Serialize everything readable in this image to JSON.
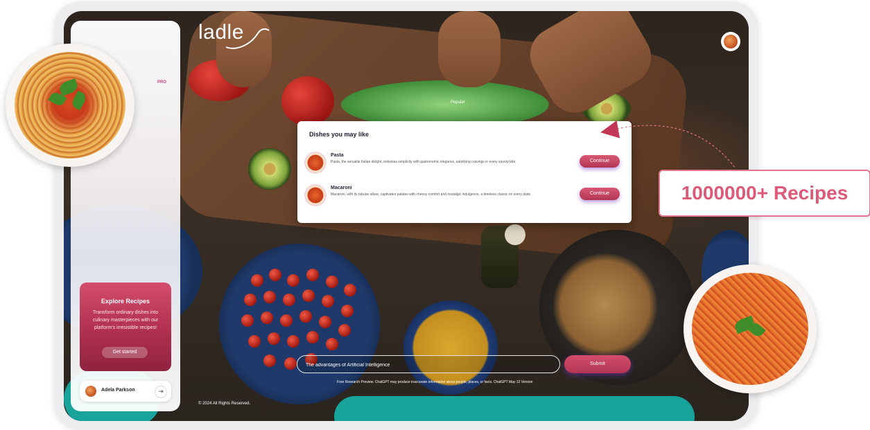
{
  "app": {
    "logo": "ladle",
    "pro_tag": "PRO"
  },
  "sidebar": {
    "explore": {
      "title": "Explore Recipes",
      "text": "Transform ordinary dishes into culinary masterpieces with our platform's irresistible recipes!",
      "button": "Get started"
    },
    "user": {
      "name": "Adela Parkson",
      "logout_icon": "logout-icon"
    }
  },
  "main": {
    "popular_label": "Popular",
    "modal": {
      "title": "Dishes you may like",
      "dishes": [
        {
          "name": "Pasta",
          "description": "Pasta, the versatile Italian delight, entwines simplicity with gastronomic elegance, satisfying cravings in every savory bite.",
          "button": "Continue"
        },
        {
          "name": "Macaroni",
          "description": "Macaroni, with its tubular allure, captivates palates with cheesy comfort and nostalgic indulgence, a timeless classic on every plate.",
          "button": "Continue"
        }
      ]
    },
    "search": {
      "placeholder": "The advantages of Artificial Intelligence"
    },
    "submit_label": "Submit",
    "disclaimer": "Free Research Preview. ChatGPT may produce inaccurate information about people, places, or facts. ChatGPT May 12 Version",
    "copyright": "© 2024 All Rights Reserved."
  },
  "callout": {
    "text": "1000000+ Recipes"
  },
  "colors": {
    "accent": "#c23656",
    "callout_text": "#dc5a78"
  }
}
